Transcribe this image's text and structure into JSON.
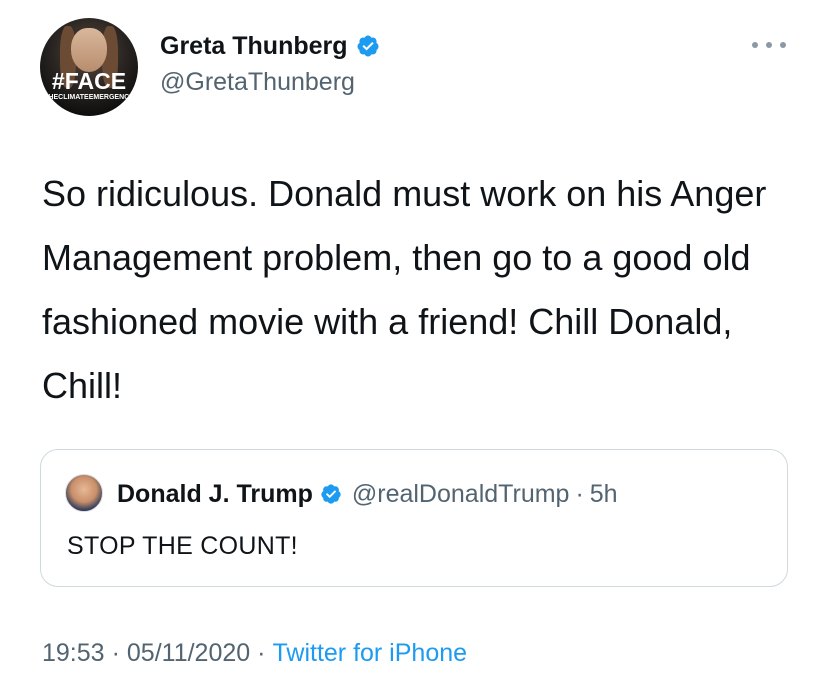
{
  "author": {
    "name": "Greta Thunberg",
    "handle": "@GretaThunberg",
    "avatar_overlay_main": "#FACE",
    "avatar_overlay_sub": "THECLIMATEEMERGENCY",
    "verified_icon": "verified-badge-icon"
  },
  "tweet": {
    "text": "So ridiculous. Donald must work on his Anger Management problem, then go to a good old fashioned movie with a friend! Chill Donald, Chill!"
  },
  "quoted_tweet": {
    "name": "Donald J. Trump",
    "handle": "@realDonaldTrump",
    "separator": "·",
    "time": "5h",
    "text": "STOP THE COUNT!"
  },
  "meta": {
    "time": "19:53",
    "separator": "·",
    "date": "05/11/2020",
    "source": "Twitter for iPhone"
  },
  "colors": {
    "accent": "#1d9bf0",
    "text_primary": "#0f1419",
    "text_secondary": "#536471",
    "border": "#cfd9de"
  }
}
